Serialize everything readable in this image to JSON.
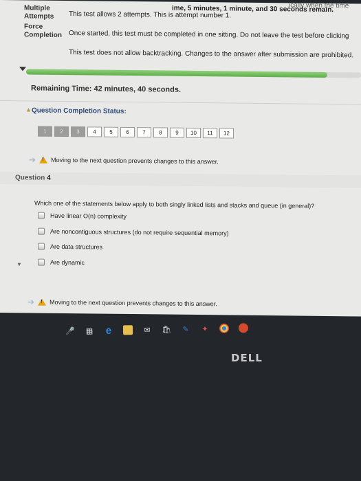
{
  "top_info": {
    "partial_line_right": "ically when the time",
    "partial_line_left": "ime, 5 minutes, 1 minute, and 30 seconds remain.",
    "multiple_attempts_label": "Multiple Attempts",
    "multiple_attempts_text": "This test allows 2 attempts. This is attempt number 1.",
    "force_completion_label": "Force Completion",
    "force_completion_text": "Once started, this test must be completed in one sitting. Do not leave the test before clicking",
    "backtracking_text": "This test does not allow backtracking. Changes to the answer after submission are prohibited."
  },
  "timer": {
    "remaining_text": "Remaining Time: 42 minutes, 40 seconds.",
    "progress_fraction": 0.9
  },
  "completion_status": {
    "title": "Question Completion Status:",
    "questions": [
      {
        "num": "1",
        "answered": true
      },
      {
        "num": "2",
        "answered": true
      },
      {
        "num": "3",
        "answered": true
      },
      {
        "num": "4",
        "answered": false
      },
      {
        "num": "5",
        "answered": false
      },
      {
        "num": "6",
        "answered": false
      },
      {
        "num": "7",
        "answered": false
      },
      {
        "num": "8",
        "answered": false
      },
      {
        "num": "9",
        "answered": false
      },
      {
        "num": "10",
        "answered": false
      },
      {
        "num": "11",
        "answered": false
      },
      {
        "num": "12",
        "answered": false
      }
    ]
  },
  "warning_top": "Moving to the next question prevents changes to this answer.",
  "question": {
    "label": "Question",
    "number": "4",
    "text": "Which one of the statements below apply to both singly linked lists and stacks and queue (in general)?",
    "options": [
      "Have linear O(n) complexity",
      "Are noncontiguous structures (do not require sequential memory)",
      "Are data structures",
      "Are dynamic"
    ]
  },
  "warning_bottom": "Moving to the next question prevents changes to this answer.",
  "taskbar": {
    "icons": [
      "microphone-icon",
      "task-view-icon",
      "edge-icon",
      "file-explorer-icon",
      "mail-icon",
      "store-icon",
      "pen-icon",
      "app-icon",
      "chrome-icon",
      "app-red-icon"
    ]
  },
  "hardware": {
    "brand": "DELL"
  },
  "colors": {
    "page_bg": "#e9e9e7",
    "status_title": "#2b4a79",
    "progress_green": "#5fae4a",
    "warning": "#e8a200"
  }
}
